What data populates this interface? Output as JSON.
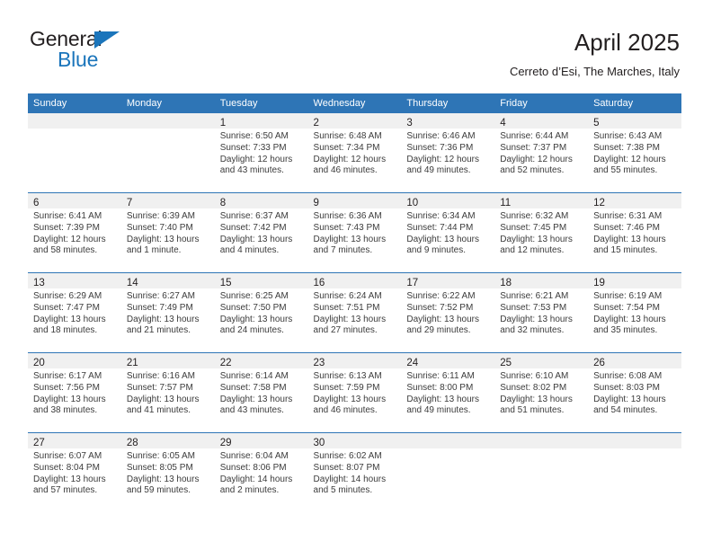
{
  "brand": {
    "name_line1": "General",
    "name_line2": "Blue",
    "triangle_icon": "blue-triangle-icon",
    "colors": {
      "text": "#231f20",
      "accent": "#1b75bb"
    }
  },
  "header": {
    "title": "April 2025",
    "subtitle": "Cerreto d’Esi, The Marches, Italy"
  },
  "calendar": {
    "accent_color": "#2e75b6",
    "day_band_color": "#f0f0f0",
    "weekday_headers": [
      "Sunday",
      "Monday",
      "Tuesday",
      "Wednesday",
      "Thursday",
      "Friday",
      "Saturday"
    ],
    "weeks": [
      [
        {
          "day": "",
          "lines": []
        },
        {
          "day": "",
          "lines": []
        },
        {
          "day": "1",
          "lines": [
            "Sunrise: 6:50 AM",
            "Sunset: 7:33 PM",
            "Daylight: 12 hours",
            "and 43 minutes."
          ]
        },
        {
          "day": "2",
          "lines": [
            "Sunrise: 6:48 AM",
            "Sunset: 7:34 PM",
            "Daylight: 12 hours",
            "and 46 minutes."
          ]
        },
        {
          "day": "3",
          "lines": [
            "Sunrise: 6:46 AM",
            "Sunset: 7:36 PM",
            "Daylight: 12 hours",
            "and 49 minutes."
          ]
        },
        {
          "day": "4",
          "lines": [
            "Sunrise: 6:44 AM",
            "Sunset: 7:37 PM",
            "Daylight: 12 hours",
            "and 52 minutes."
          ]
        },
        {
          "day": "5",
          "lines": [
            "Sunrise: 6:43 AM",
            "Sunset: 7:38 PM",
            "Daylight: 12 hours",
            "and 55 minutes."
          ]
        }
      ],
      [
        {
          "day": "6",
          "lines": [
            "Sunrise: 6:41 AM",
            "Sunset: 7:39 PM",
            "Daylight: 12 hours",
            "and 58 minutes."
          ]
        },
        {
          "day": "7",
          "lines": [
            "Sunrise: 6:39 AM",
            "Sunset: 7:40 PM",
            "Daylight: 13 hours",
            "and 1 minute."
          ]
        },
        {
          "day": "8",
          "lines": [
            "Sunrise: 6:37 AM",
            "Sunset: 7:42 PM",
            "Daylight: 13 hours",
            "and 4 minutes."
          ]
        },
        {
          "day": "9",
          "lines": [
            "Sunrise: 6:36 AM",
            "Sunset: 7:43 PM",
            "Daylight: 13 hours",
            "and 7 minutes."
          ]
        },
        {
          "day": "10",
          "lines": [
            "Sunrise: 6:34 AM",
            "Sunset: 7:44 PM",
            "Daylight: 13 hours",
            "and 9 minutes."
          ]
        },
        {
          "day": "11",
          "lines": [
            "Sunrise: 6:32 AM",
            "Sunset: 7:45 PM",
            "Daylight: 13 hours",
            "and 12 minutes."
          ]
        },
        {
          "day": "12",
          "lines": [
            "Sunrise: 6:31 AM",
            "Sunset: 7:46 PM",
            "Daylight: 13 hours",
            "and 15 minutes."
          ]
        }
      ],
      [
        {
          "day": "13",
          "lines": [
            "Sunrise: 6:29 AM",
            "Sunset: 7:47 PM",
            "Daylight: 13 hours",
            "and 18 minutes."
          ]
        },
        {
          "day": "14",
          "lines": [
            "Sunrise: 6:27 AM",
            "Sunset: 7:49 PM",
            "Daylight: 13 hours",
            "and 21 minutes."
          ]
        },
        {
          "day": "15",
          "lines": [
            "Sunrise: 6:25 AM",
            "Sunset: 7:50 PM",
            "Daylight: 13 hours",
            "and 24 minutes."
          ]
        },
        {
          "day": "16",
          "lines": [
            "Sunrise: 6:24 AM",
            "Sunset: 7:51 PM",
            "Daylight: 13 hours",
            "and 27 minutes."
          ]
        },
        {
          "day": "17",
          "lines": [
            "Sunrise: 6:22 AM",
            "Sunset: 7:52 PM",
            "Daylight: 13 hours",
            "and 29 minutes."
          ]
        },
        {
          "day": "18",
          "lines": [
            "Sunrise: 6:21 AM",
            "Sunset: 7:53 PM",
            "Daylight: 13 hours",
            "and 32 minutes."
          ]
        },
        {
          "day": "19",
          "lines": [
            "Sunrise: 6:19 AM",
            "Sunset: 7:54 PM",
            "Daylight: 13 hours",
            "and 35 minutes."
          ]
        }
      ],
      [
        {
          "day": "20",
          "lines": [
            "Sunrise: 6:17 AM",
            "Sunset: 7:56 PM",
            "Daylight: 13 hours",
            "and 38 minutes."
          ]
        },
        {
          "day": "21",
          "lines": [
            "Sunrise: 6:16 AM",
            "Sunset: 7:57 PM",
            "Daylight: 13 hours",
            "and 41 minutes."
          ]
        },
        {
          "day": "22",
          "lines": [
            "Sunrise: 6:14 AM",
            "Sunset: 7:58 PM",
            "Daylight: 13 hours",
            "and 43 minutes."
          ]
        },
        {
          "day": "23",
          "lines": [
            "Sunrise: 6:13 AM",
            "Sunset: 7:59 PM",
            "Daylight: 13 hours",
            "and 46 minutes."
          ]
        },
        {
          "day": "24",
          "lines": [
            "Sunrise: 6:11 AM",
            "Sunset: 8:00 PM",
            "Daylight: 13 hours",
            "and 49 minutes."
          ]
        },
        {
          "day": "25",
          "lines": [
            "Sunrise: 6:10 AM",
            "Sunset: 8:02 PM",
            "Daylight: 13 hours",
            "and 51 minutes."
          ]
        },
        {
          "day": "26",
          "lines": [
            "Sunrise: 6:08 AM",
            "Sunset: 8:03 PM",
            "Daylight: 13 hours",
            "and 54 minutes."
          ]
        }
      ],
      [
        {
          "day": "27",
          "lines": [
            "Sunrise: 6:07 AM",
            "Sunset: 8:04 PM",
            "Daylight: 13 hours",
            "and 57 minutes."
          ]
        },
        {
          "day": "28",
          "lines": [
            "Sunrise: 6:05 AM",
            "Sunset: 8:05 PM",
            "Daylight: 13 hours",
            "and 59 minutes."
          ]
        },
        {
          "day": "29",
          "lines": [
            "Sunrise: 6:04 AM",
            "Sunset: 8:06 PM",
            "Daylight: 14 hours",
            "and 2 minutes."
          ]
        },
        {
          "day": "30",
          "lines": [
            "Sunrise: 6:02 AM",
            "Sunset: 8:07 PM",
            "Daylight: 14 hours",
            "and 5 minutes."
          ]
        },
        {
          "day": "",
          "lines": []
        },
        {
          "day": "",
          "lines": []
        },
        {
          "day": "",
          "lines": []
        }
      ]
    ]
  }
}
